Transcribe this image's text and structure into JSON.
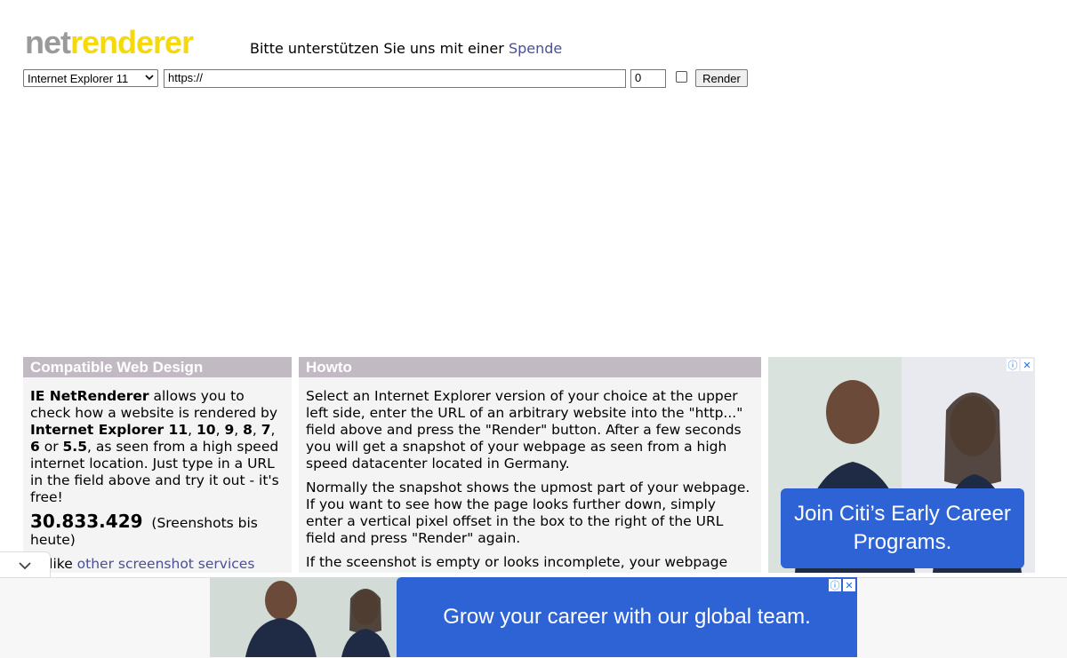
{
  "logo": {
    "part1": "net",
    "part2": "renderer"
  },
  "support": {
    "text": "Bitte unterstützen Sie uns mit einer ",
    "link": "Spende"
  },
  "toolbar": {
    "browser_selected": "Internet Explorer 11",
    "url_value": "https://",
    "offset_value": "0",
    "checkbox_checked": false,
    "render_label": "Render"
  },
  "box1": {
    "title": "Compatible Web Design",
    "p1_bold": "IE NetRenderer",
    "p1_a": " allows you to check how a website is rendered by ",
    "v1": "Internet Explorer 11",
    "s1": ", ",
    "v2": "10",
    "s2": ", ",
    "v3": "9",
    "s3": ", ",
    "v4": "8",
    "s4": ", ",
    "v5": "7",
    "s5": ", ",
    "v6": "6",
    "s6": " or ",
    "v7": "5.5",
    "p1_end": ", as seen from a high speed internet location. Just type in a URL in the field above and try it out - it's free!",
    "count": "30.833.429",
    "count_label": "(Sreenshots bis heute)",
    "p3_prefix": "Unlike ",
    "p3_link": "other screenshot services"
  },
  "box2": {
    "title": "Howto",
    "p1": "Select an Internet Explorer version of your choice at the upper left side, enter the URL of an arbitrary website into the \"http...\" field above and press the \"Render\" button. After a few seconds you will get a snapshot of your webpage as seen from a high speed datacenter located in Germany.",
    "p2": "Normally the snapshot shows the upmost part of your webpage. If you want to see how the page looks further down, simply enter a vertical pixel offset in the box to the right of the URL field and press \"Render\" again.",
    "p3": "If the sceenshot is empty or looks incomplete, your webpage"
  },
  "ad1": {
    "cta": "Join Citi’s Early Career Programs."
  },
  "ad2": {
    "cta": "Grow your career with our global team."
  },
  "colors": {
    "accent_blue": "#2e63d6",
    "header_bg": "#c2bac3",
    "logo_gray": "#9a9a9a",
    "logo_yellow": "#f5d90a",
    "link": "#4b4f93"
  }
}
